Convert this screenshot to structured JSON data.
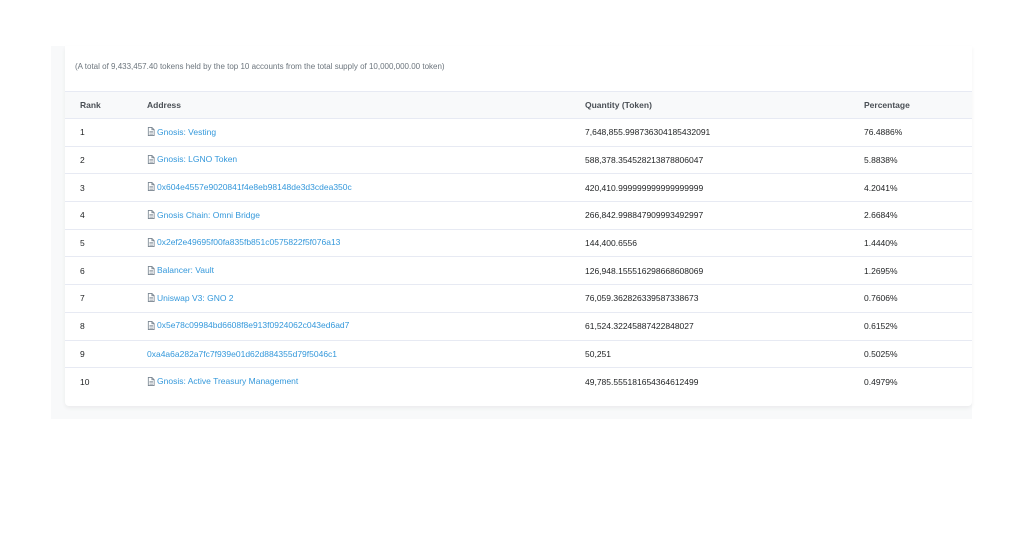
{
  "summary_text": "(A total of 9,433,457.40 tokens held by the top 10 accounts from the total supply of 10,000,000.00 token)",
  "columns": {
    "rank": "Rank",
    "address": "Address",
    "quantity": "Quantity (Token)",
    "percentage": "Percentage"
  },
  "rows": [
    {
      "rank": "1",
      "address": "Gnosis: Vesting",
      "contract": true,
      "quantity": "7,648,855.998736304185432091",
      "percentage": "76.4886%"
    },
    {
      "rank": "2",
      "address": "Gnosis: LGNO Token",
      "contract": true,
      "quantity": "588,378.354528213878806047",
      "percentage": "5.8838%"
    },
    {
      "rank": "3",
      "address": "0x604e4557e9020841f4e8eb98148de3d3cdea350c",
      "contract": true,
      "quantity": "420,410.999999999999999999",
      "percentage": "4.2041%"
    },
    {
      "rank": "4",
      "address": "Gnosis Chain: Omni Bridge",
      "contract": true,
      "quantity": "266,842.998847909993492997",
      "percentage": "2.6684%"
    },
    {
      "rank": "5",
      "address": "0x2ef2e49695f00fa835fb851c0575822f5f076a13",
      "contract": true,
      "quantity": "144,400.6556",
      "percentage": "1.4440%"
    },
    {
      "rank": "6",
      "address": "Balancer: Vault",
      "contract": true,
      "quantity": "126,948.155516298668608069",
      "percentage": "1.2695%"
    },
    {
      "rank": "7",
      "address": "Uniswap V3: GNO 2",
      "contract": true,
      "quantity": "76,059.362826339587338673",
      "percentage": "0.7606%"
    },
    {
      "rank": "8",
      "address": "0x5e78c09984bd6608f8e913f0924062c043ed6ad7",
      "contract": true,
      "quantity": "61,524.32245887422848027",
      "percentage": "0.6152%"
    },
    {
      "rank": "9",
      "address": "0xa4a6a282a7fc7f939e01d62d884355d79f5046c1",
      "contract": false,
      "quantity": "50,251",
      "percentage": "0.5025%"
    },
    {
      "rank": "10",
      "address": "Gnosis: Active Treasury Management",
      "contract": true,
      "quantity": "49,785.555181654364612499",
      "percentage": "0.4979%"
    }
  ],
  "colors": {
    "link": "#3498db",
    "text": "#1e2022",
    "muted": "#6c757d",
    "border": "#e7eaf3",
    "header_bg": "#f8f9fa"
  },
  "icons": {
    "contract": "document-icon"
  }
}
